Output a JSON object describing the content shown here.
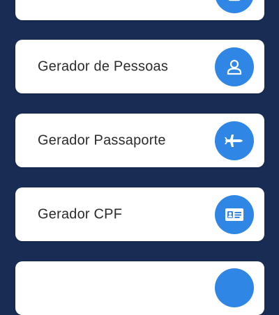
{
  "items": [
    {
      "label": "",
      "icon": "partial-icon"
    },
    {
      "label": "Gerador de Pessoas",
      "icon": "person-icon"
    },
    {
      "label": "Gerador Passaporte",
      "icon": "airplane-icon"
    },
    {
      "label": "Gerador CPF",
      "icon": "id-card-icon"
    },
    {
      "label": "",
      "icon": "partial-icon"
    }
  ],
  "colors": {
    "background": "#182c54",
    "card": "#ffffff",
    "accent": "#2f86e5",
    "text": "#2b2b2b"
  }
}
